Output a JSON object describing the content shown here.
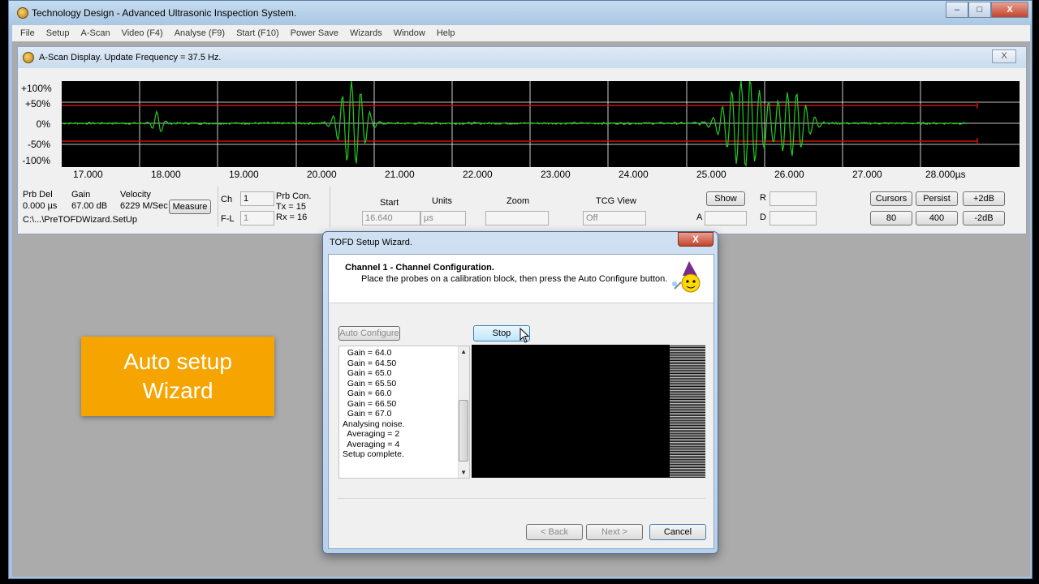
{
  "app": {
    "title": "Technology Design - Advanced Ultrasonic Inspection System.",
    "window_buttons": [
      "–",
      "□",
      "X"
    ]
  },
  "menu": [
    "File",
    "Setup",
    "A-Scan",
    "Video (F4)",
    "Analyse (F9)",
    "Start (F10)",
    "Power Save",
    "Wizards",
    "Window",
    "Help"
  ],
  "ascan": {
    "title": "A-Scan Display. Update Frequency = 37.5 Hz.",
    "close": "X",
    "y_labels": [
      "+100%",
      "+50%",
      "0%",
      "-50%",
      "-100%"
    ],
    "x_labels": [
      "17.000",
      "18.000",
      "19.000",
      "20.000",
      "21.000",
      "22.000",
      "23.000",
      "24.000",
      "25.000",
      "26.000",
      "27.000",
      "28.000µs"
    ],
    "colors": {
      "trace": "#22cc22",
      "gate": "#cc1111",
      "grid": "#ffffff",
      "background": "#000000"
    },
    "panel": {
      "prb_del_label": "Prb Del",
      "prb_del_value": "0.000 µs",
      "gain_label": "Gain",
      "gain_value": "67.00 dB",
      "velocity_label": "Velocity",
      "velocity_value": "6229 M/Sec",
      "measure": "Measure",
      "path": "C:\\...\\PreTOFDWizard.SetUp",
      "ch_label": "Ch",
      "ch_value": "1",
      "fl_label": "F-L",
      "fl_value": "1",
      "prb_con": "Prb Con.",
      "tx": "Tx = 15",
      "rx": "Rx = 16",
      "start_label": "Start",
      "start_value": "16.640",
      "units_label": "Units",
      "units_value": "µs",
      "zoom_label": "Zoom",
      "zoom_value": "",
      "tcg_label": "TCG View",
      "tcg_value": "Off",
      "show": "Show",
      "r_label": "R",
      "a_label": "A",
      "d_label": "D",
      "cursors": "Cursors",
      "persist": "Persist",
      "plus2db": "+2dB",
      "b80": "80",
      "b400": "400",
      "minus2db": "-2dB"
    }
  },
  "overlay": {
    "line1": "Auto setup",
    "line2": "Wizard",
    "color": "#f5a400"
  },
  "dialog": {
    "title": "TOFD Setup Wizard.",
    "close": "X",
    "heading": "Channel 1   -   Channel Configuration.",
    "subheading": "Place the probes on a calibration block, then press the Auto Configure button.",
    "auto_configure": "Auto Configure",
    "stop": "Stop",
    "log": [
      "  Gain = 64.0",
      "  Gain = 64.50",
      "  Gain = 65.0",
      "  Gain = 65.50",
      "  Gain = 66.0",
      "  Gain = 66.50",
      "  Gain = 67.0",
      "Analysing noise.",
      "  Averaging = 2",
      "  Averaging = 4",
      "Setup complete."
    ],
    "back": "< Back",
    "next": "Next >",
    "cancel": "Cancel"
  }
}
